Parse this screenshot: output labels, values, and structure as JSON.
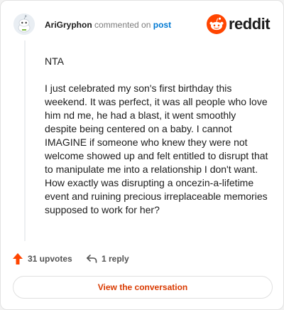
{
  "comment": {
    "username": "AriGryphon",
    "action_text": "commented on",
    "target_link": "post",
    "paragraphs": [
      "NTA",
      "I just celebrated my son's first birthday this weekend. It was perfect, it was all people who love him nd me, he had a blast, it went smoothly despite being centered on a baby. I cannot IMAGINE if someone who knew they were not welcome showed up and felt entitled to disrupt that to manipulate me into a relationship I don't want. How exactly was disrupting a oncezin-a-lifetime event and ruining precious irreplaceable memories supposed to work for her?"
    ]
  },
  "brand": {
    "wordmark": "reddit",
    "icon": "reddit-snoo-icon",
    "accent_color": "#ff4500"
  },
  "actions": {
    "upvotes_label": "31 upvotes",
    "upvote_icon": "upvote-arrow-icon",
    "reply_label": "1 reply",
    "reply_icon": "reply-arrow-icon"
  },
  "footer": {
    "button_label": "View the conversation"
  }
}
